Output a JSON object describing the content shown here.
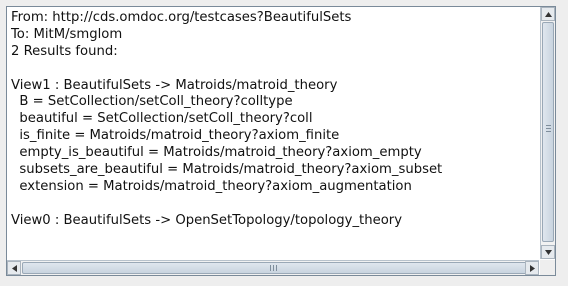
{
  "results_text": {
    "lines": [
      "From: http://cds.omdoc.org/testcases?BeautifulSets",
      "To: MitM/smglom",
      "2 Results found:",
      "",
      "View1 : BeautifulSets -> Matroids/matroid_theory",
      "  B = SetCollection/setColl_theory?colltype",
      "  beautiful = SetCollection/setColl_theory?coll",
      "  is_finite = Matroids/matroid_theory?axiom_finite",
      "  empty_is_beautiful = Matroids/matroid_theory?axiom_empty",
      "  subsets_are_beautiful = Matroids/matroid_theory?axiom_subset",
      "  extension = Matroids/matroid_theory?axiom_augmentation",
      "",
      "View0 : BeautifulSets -> OpenSetTopology/topology_theory"
    ]
  },
  "scrollbars": {
    "up_arrow_icon": "triangle-up",
    "down_arrow_icon": "triangle-down",
    "left_arrow_icon": "triangle-left",
    "right_arrow_icon": "triangle-right"
  }
}
